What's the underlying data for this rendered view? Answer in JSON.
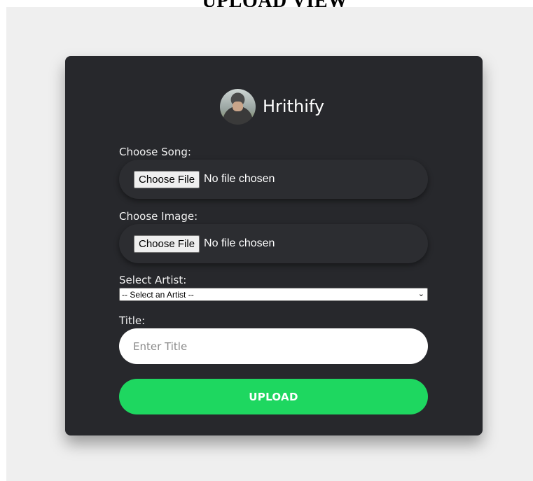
{
  "page": {
    "heading": "UPLOAD VIEW"
  },
  "brand": {
    "name": "Hrithify",
    "avatar_icon": "user-avatar-photo"
  },
  "form": {
    "song": {
      "label": "Choose Song:",
      "button_label": "Choose File",
      "status": "No file chosen"
    },
    "image": {
      "label": "Choose Image:",
      "button_label": "Choose File",
      "status": "No file chosen"
    },
    "artist": {
      "label": "Select Artist:",
      "selected": "-- Select an Artist --",
      "chevron_icon": "chevron-down-icon"
    },
    "title": {
      "label": "Title:",
      "value": "",
      "placeholder": "Enter Title"
    },
    "submit_label": "UPLOAD"
  },
  "colors": {
    "page_background": "#efefef",
    "card_background": "#27282c",
    "accent": "#1ed760",
    "text": "#ffffff"
  }
}
